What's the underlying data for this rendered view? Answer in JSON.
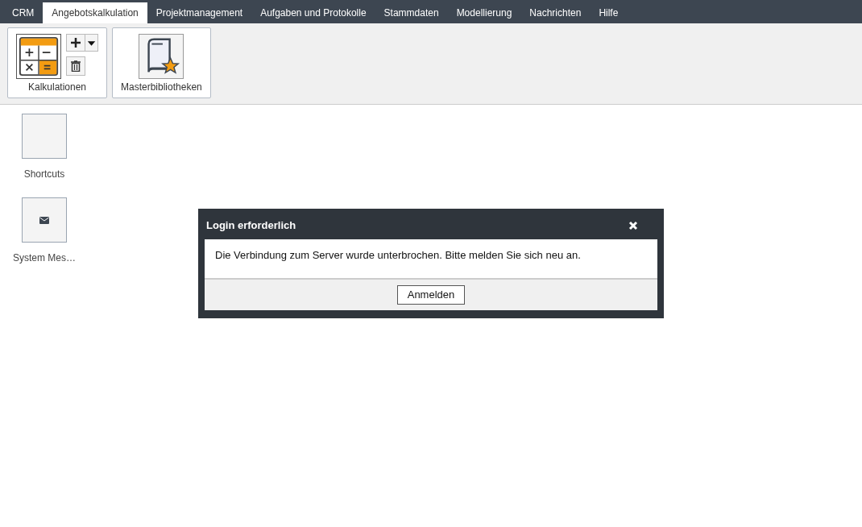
{
  "menu_tabs": [
    {
      "label": "CRM",
      "selected": false
    },
    {
      "label": "Angebotskalkulation",
      "selected": true
    },
    {
      "label": "Projektmanagement",
      "selected": false
    },
    {
      "label": "Aufgaben und Protokolle",
      "selected": false
    },
    {
      "label": "Stammdaten",
      "selected": false
    },
    {
      "label": "Modellierung",
      "selected": false
    },
    {
      "label": "Nachrichten",
      "selected": false
    },
    {
      "label": "Hilfe",
      "selected": false
    }
  ],
  "ribbon": [
    {
      "kind": "calculations",
      "label": "Kalkulationen"
    },
    {
      "kind": "library",
      "label": "Masterbibliotheken"
    }
  ],
  "tiles": [
    {
      "kind": "empty",
      "label": "Shortcuts"
    },
    {
      "kind": "mail",
      "label": "System Mes…"
    }
  ],
  "dialog": {
    "title": "Login erforderlich",
    "message": "Die Verbindung zum Server wurde unterbrochen. Bitte melden Sie sich neu an.",
    "button": "Anmelden"
  }
}
